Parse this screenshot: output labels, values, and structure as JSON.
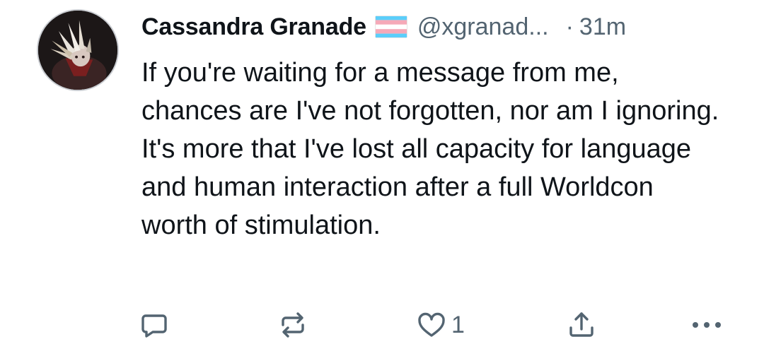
{
  "post": {
    "author": {
      "display_name": "Cassandra Granade",
      "flag_icon": "transgender-flag-icon",
      "handle": "@xgranad...",
      "separator": "·",
      "time": "31m"
    },
    "text": "If you're waiting for a message from me, chances are I've not forgotten, nor am I ignoring. It's more that I've lost all capacity for language and human interaction after a full Worldcon worth of stimulation.",
    "actions": {
      "reply_icon": "speech-bubble-icon",
      "repost_icon": "repost-arrows-icon",
      "like_icon": "heart-icon",
      "like_count": "1",
      "share_icon": "share-upload-icon",
      "more_icon": "more-dots-icon"
    },
    "colors": {
      "text_primary": "#0f1419",
      "text_secondary": "#536471",
      "icon": "#536471",
      "flag_blue": "#5bcefa",
      "flag_pink": "#f5a9b8",
      "flag_white": "#ffffff"
    }
  }
}
